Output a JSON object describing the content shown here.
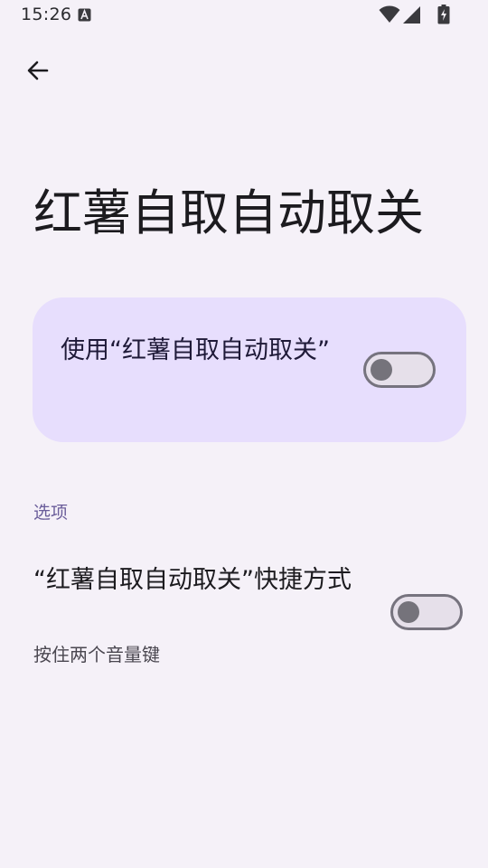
{
  "status_bar": {
    "time": "15:26",
    "notification_icon": "a-box-icon",
    "wifi_icon": "wifi-icon",
    "signal_icon": "cell-signal-icon",
    "battery_icon": "battery-charging-icon"
  },
  "toolbar": {
    "back_icon": "arrow-back-icon"
  },
  "page": {
    "title": "红薯自取自动取关"
  },
  "main_toggle": {
    "label": "使用“红薯自取自动取关”",
    "state": "off"
  },
  "options": {
    "header": "选项",
    "shortcut": {
      "title": "“红薯自取自动取关”快捷方式",
      "summary": "按住两个音量键",
      "state": "off"
    }
  },
  "colors": {
    "background": "#f5f1f8",
    "card": "#e7defd",
    "accent_text": "#6a5d9a",
    "switch_outline": "#76737e"
  }
}
